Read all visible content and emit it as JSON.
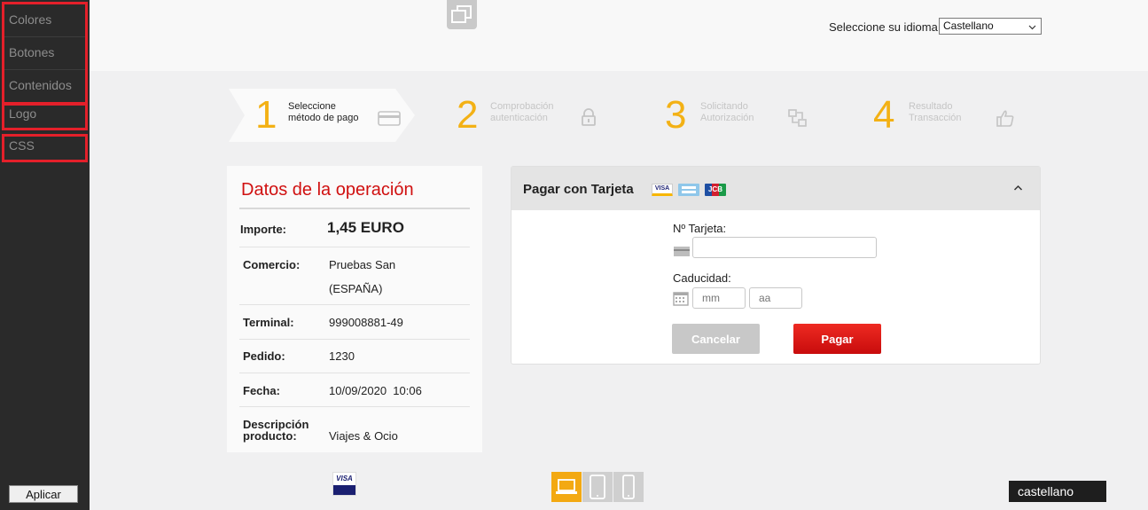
{
  "sidebar": {
    "items": [
      "Colores",
      "Botones",
      "Contenidos",
      "Logo",
      "CSS"
    ],
    "apply_label": "Aplicar"
  },
  "header": {
    "language_label": "Seleccione su idioma",
    "language_value": "Castellano"
  },
  "steps": [
    {
      "number": "1",
      "line1": "Seleccione",
      "line2": "método de pago",
      "icon": "credit-card-icon",
      "active": true
    },
    {
      "number": "2",
      "line1": "Comprobación",
      "line2": "autenticación",
      "icon": "lock-icon",
      "active": false
    },
    {
      "number": "3",
      "line1": "Solicitando",
      "line2": "Autorización",
      "icon": "transfer-icon",
      "active": false
    },
    {
      "number": "4",
      "line1": "Resultado",
      "line2": "Transacción",
      "icon": "thumbs-up-icon",
      "active": false
    }
  ],
  "operation": {
    "title": "Datos de la operación",
    "importe_label": "Importe:",
    "importe_value": "1,45 EURO",
    "comercio_label": "Comercio:",
    "comercio_line1": "Pruebas San",
    "comercio_line2": "(ESPAÑA)",
    "terminal_label": "Terminal:",
    "terminal_value": "999008881-49",
    "pedido_label": "Pedido:",
    "pedido_value": "1230",
    "fecha_label": "Fecha:",
    "fecha_value": "10/09/2020  10:06",
    "descripcion_label_line1": "Descripción",
    "descripcion_label_line2": "producto:",
    "descripcion_value": "Viajes & Ocio"
  },
  "card": {
    "title": "Pagar con Tarjeta",
    "brand_visa": "VISA",
    "brand_jcb": "JCB",
    "card_number_label": "Nº Tarjeta:",
    "card_number_value": "",
    "expiry_label": "Caducidad:",
    "month_placeholder": "mm",
    "year_placeholder": "aa",
    "cancel_label": "Cancelar",
    "pay_label": "Pagar"
  },
  "footer": {
    "visa_secure_text": "VISA",
    "language": "castellano"
  },
  "colors": {
    "accent_yellow": "#f3b115",
    "title_red": "#d01010",
    "pay_red": "#e01a16",
    "sidebar_bg": "#2a2a2a",
    "highlight_red": "#e4202a"
  }
}
